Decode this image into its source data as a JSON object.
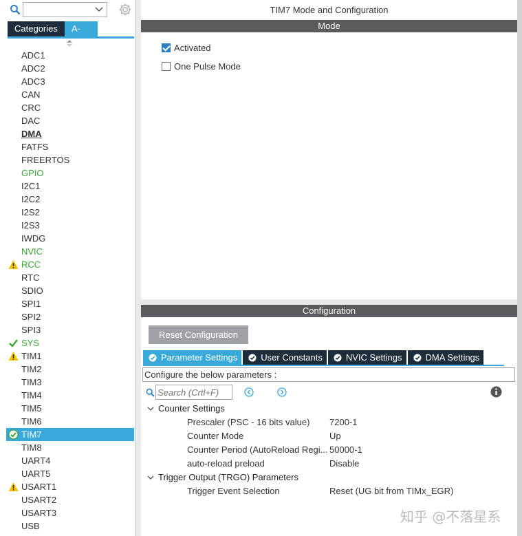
{
  "sidebar": {
    "search_placeholder": "",
    "tabs": [
      {
        "label": "Categories",
        "active": false
      },
      {
        "label": "A->Z",
        "active": true
      }
    ],
    "items": [
      {
        "label": "ADC1",
        "style": "normal",
        "icon": ""
      },
      {
        "label": "ADC2",
        "style": "normal",
        "icon": ""
      },
      {
        "label": "ADC3",
        "style": "normal",
        "icon": ""
      },
      {
        "label": "CAN",
        "style": "normal",
        "icon": ""
      },
      {
        "label": "CRC",
        "style": "normal",
        "icon": ""
      },
      {
        "label": "DAC",
        "style": "normal",
        "icon": ""
      },
      {
        "label": "DMA",
        "style": "bold",
        "icon": ""
      },
      {
        "label": "FATFS",
        "style": "normal",
        "icon": ""
      },
      {
        "label": "FREERTOS",
        "style": "normal",
        "icon": ""
      },
      {
        "label": "GPIO",
        "style": "green",
        "icon": ""
      },
      {
        "label": "I2C1",
        "style": "normal",
        "icon": ""
      },
      {
        "label": "I2C2",
        "style": "normal",
        "icon": ""
      },
      {
        "label": "I2S2",
        "style": "normal",
        "icon": ""
      },
      {
        "label": "I2S3",
        "style": "normal",
        "icon": ""
      },
      {
        "label": "IWDG",
        "style": "normal",
        "icon": ""
      },
      {
        "label": "NVIC",
        "style": "green",
        "icon": ""
      },
      {
        "label": "RCC",
        "style": "green",
        "icon": "warning-icon"
      },
      {
        "label": "RTC",
        "style": "normal",
        "icon": ""
      },
      {
        "label": "SDIO",
        "style": "normal",
        "icon": ""
      },
      {
        "label": "SPI1",
        "style": "normal",
        "icon": ""
      },
      {
        "label": "SPI2",
        "style": "normal",
        "icon": ""
      },
      {
        "label": "SPI3",
        "style": "normal",
        "icon": ""
      },
      {
        "label": "SYS",
        "style": "green",
        "icon": "check-icon"
      },
      {
        "label": "TIM1",
        "style": "normal",
        "icon": "warning-icon"
      },
      {
        "label": "TIM2",
        "style": "normal",
        "icon": ""
      },
      {
        "label": "TIM3",
        "style": "normal",
        "icon": ""
      },
      {
        "label": "TIM4",
        "style": "normal",
        "icon": ""
      },
      {
        "label": "TIM5",
        "style": "normal",
        "icon": ""
      },
      {
        "label": "TIM6",
        "style": "normal",
        "icon": ""
      },
      {
        "label": "TIM7",
        "style": "selected",
        "icon": "check-circle-icon"
      },
      {
        "label": "TIM8",
        "style": "normal",
        "icon": ""
      },
      {
        "label": "UART4",
        "style": "normal",
        "icon": ""
      },
      {
        "label": "UART5",
        "style": "normal",
        "icon": ""
      },
      {
        "label": "USART1",
        "style": "normal",
        "icon": "warning-icon"
      },
      {
        "label": "USART2",
        "style": "normal",
        "icon": ""
      },
      {
        "label": "USART3",
        "style": "normal",
        "icon": ""
      },
      {
        "label": "USB",
        "style": "normal",
        "icon": ""
      }
    ]
  },
  "main": {
    "title": "TIM7 Mode and Configuration",
    "mode": {
      "header": "Mode",
      "options": [
        {
          "label": "Activated",
          "checked": true
        },
        {
          "label": "One Pulse Mode",
          "checked": false
        }
      ]
    },
    "configuration": {
      "header": "Configuration",
      "reset_label": "Reset Configuration",
      "tabs": [
        {
          "label": "Parameter Settings",
          "active": true
        },
        {
          "label": "User Constants",
          "active": false
        },
        {
          "label": "NVIC Settings",
          "active": false
        },
        {
          "label": "DMA Settings",
          "active": false
        }
      ],
      "description": "Configure the below parameters :",
      "search_placeholder": "Search (Crtl+F)",
      "groups": [
        {
          "label": "Counter Settings",
          "params": [
            {
              "name": "Prescaler (PSC - 16 bits value)",
              "value": "7200-1"
            },
            {
              "name": "Counter Mode",
              "value": "Up"
            },
            {
              "name": "Counter Period (AutoReload Regi...",
              "value": "50000-1"
            },
            {
              "name": "auto-reload preload",
              "value": "Disable"
            }
          ]
        },
        {
          "label": "Trigger Output (TRGO) Parameters",
          "params": [
            {
              "name": "Trigger Event Selection",
              "value": "Reset (UG bit from TIMx_EGR)"
            }
          ]
        }
      ]
    }
  },
  "watermark": "知乎 @不落星系",
  "colors": {
    "accent": "#39a9dc",
    "dark_tab": "#1e2d3c",
    "section_header": "#595b5e",
    "green": "#3aa635",
    "warning": "#f2c200"
  }
}
